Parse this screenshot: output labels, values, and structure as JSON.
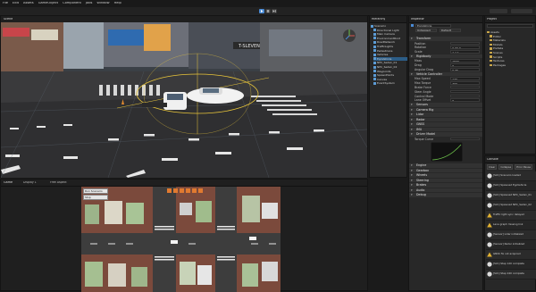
{
  "menu": {
    "items": [
      "File",
      "Edit",
      "Assets",
      "GameObject",
      "Component",
      "Jobs",
      "Window",
      "Help"
    ]
  },
  "scene_view": {
    "tab_label": "Scene",
    "signs": [
      "T-SLEVEN"
    ]
  },
  "game_view": {
    "tab_label": "Game",
    "display": "Display 1",
    "aspect": "Free Aspect",
    "button1": "Run Scenario",
    "button2": "Stop"
  },
  "hierarchy": {
    "tab_label": "Hierarchy",
    "items": [
      "Scenario",
      "Directional Light",
      "Main Camera",
      "EnvironmentRoot",
      "RoadNetwork",
      "TrafficLights",
      "Pedestrians",
      "Vehicles",
      "EgoVehicle",
      "NPC_Sedan_01",
      "NPC_Sedan_02",
      "Waypoints",
      "SpawnPoints",
      "Canvas",
      "EventSystem"
    ]
  },
  "inspector": {
    "tab_label": "Inspector",
    "object_name": "EgoVehicle",
    "tag": "Untagged",
    "layer": "Default",
    "sections": [
      "Transform",
      "Rigidbody",
      "Vehicle Controller",
      "Sensors",
      "Camera Rig",
      "Lidar",
      "Radar",
      "GNSS",
      "IMU",
      "Driver Model",
      "Engine",
      "Gearbox",
      "Wheels",
      "Steering",
      "Brakes",
      "Audio",
      "Debug"
    ],
    "fields": [
      {
        "label": "Position",
        "value": "0  0  0"
      },
      {
        "label": "Rotation",
        "value": "0  90  0"
      },
      {
        "label": "Scale",
        "value": "1  1  1"
      },
      {
        "label": "Mass",
        "value": "1500"
      },
      {
        "label": "Drag",
        "value": "0"
      },
      {
        "label": "Angular Drag",
        "value": "0.05"
      },
      {
        "label": "Max Speed",
        "value": "120"
      },
      {
        "label": "Max Torque",
        "value": "400"
      },
      {
        "label": "Brake Force",
        "value": "3000"
      },
      {
        "label": "Steer Angle",
        "value": "35"
      },
      {
        "label": "Control Mode",
        "value": "Autonomous"
      },
      {
        "label": "Lane Offset",
        "value": "0"
      },
      {
        "label": "Torque Curve",
        "value": ""
      }
    ]
  },
  "project": {
    "tab_label": "Project",
    "folders": [
      "Assets",
      "Editor",
      "Materials",
      "Models",
      "Prefabs",
      "Scenes",
      "Scripts",
      "Textures",
      "Packages"
    ]
  },
  "console": {
    "tab_label": "Console",
    "buttons": [
      "Clear",
      "Collapse",
      "Error Pause"
    ],
    "logs": [
      {
        "level": "info",
        "text": "[Sim] Scenario loaded"
      },
      {
        "level": "info",
        "text": "[Sim] Spawned EgoVehicle"
      },
      {
        "level": "info",
        "text": "[Sim] Spawned NPC_Sedan_01"
      },
      {
        "level": "info",
        "text": "[Sim] Spawned NPC_Sedan_02"
      },
      {
        "level": "warning",
        "text": "Traffic light sync delayed"
      },
      {
        "level": "warning",
        "text": "Lane graph missing link"
      },
      {
        "level": "info",
        "text": "[Sensor] Lidar initialized"
      },
      {
        "level": "info",
        "text": "[Sensor] Radar initialized"
      },
      {
        "level": "warning",
        "text": "GNSS fix not acquired"
      },
      {
        "level": "info",
        "text": "[Sim] Step 120 complete"
      },
      {
        "level": "info",
        "text": "[Sim] Step 240 complete"
      }
    ]
  },
  "colors": {
    "accent": "#3d6fb4",
    "play_active": "#4a8ad4",
    "warning": "#e0b030"
  }
}
